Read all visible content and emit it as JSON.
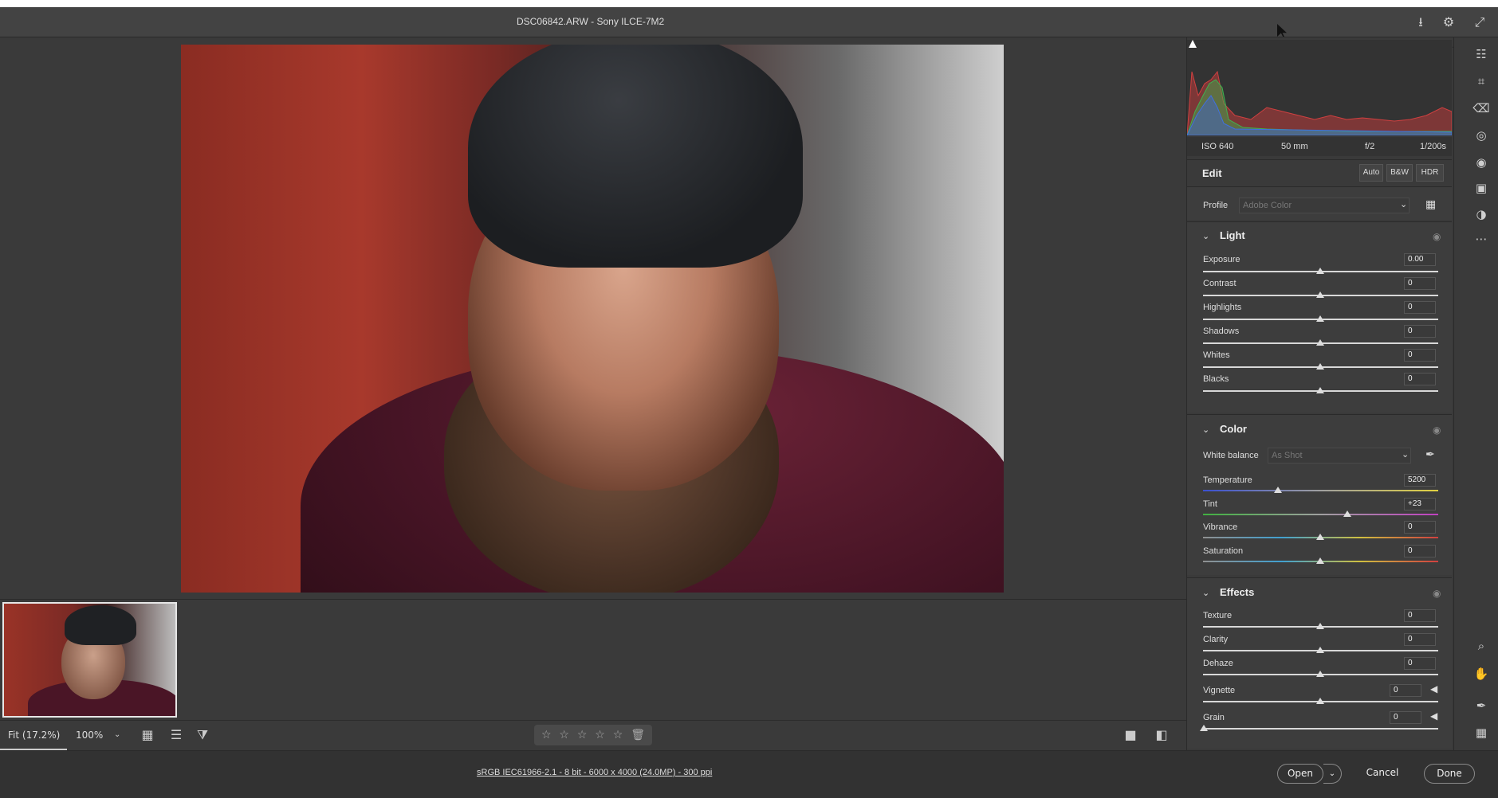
{
  "window": {
    "title": "DSC06842.ARW  -  Sony ILCE-7M2",
    "icons": [
      "download-icon",
      "gear-icon",
      "expand-icon"
    ]
  },
  "viewer": {
    "fit_label": "Fit (17.2%)",
    "zoom_label": "100%",
    "rating_stars": 0
  },
  "status": {
    "info": "sRGB IEC61966-2.1 - 8 bit - 6000 x 4000 (24.0MP) - 300 ppi",
    "open": "Open",
    "cancel": "Cancel",
    "done": "Done"
  },
  "exif": {
    "iso": "ISO 640",
    "focal": "50 mm",
    "aperture": "f/2",
    "shutter": "1/200s"
  },
  "edit": {
    "title": "Edit",
    "auto": "Auto",
    "bw": "B&W",
    "hdr": "HDR",
    "profile_label": "Profile",
    "profile_value": "Adobe Color"
  },
  "light": {
    "title": "Light",
    "exposure": {
      "label": "Exposure",
      "value": "0.00"
    },
    "contrast": {
      "label": "Contrast",
      "value": "0"
    },
    "highlights": {
      "label": "Highlights",
      "value": "0"
    },
    "shadows": {
      "label": "Shadows",
      "value": "0"
    },
    "whites": {
      "label": "Whites",
      "value": "0"
    },
    "blacks": {
      "label": "Blacks",
      "value": "0"
    }
  },
  "color": {
    "title": "Color",
    "wb_label": "White balance",
    "wb_value": "As Shot",
    "temperature": {
      "label": "Temperature",
      "value": "5200"
    },
    "tint": {
      "label": "Tint",
      "value": "+23"
    },
    "vibrance": {
      "label": "Vibrance",
      "value": "0"
    },
    "saturation": {
      "label": "Saturation",
      "value": "0"
    }
  },
  "effects": {
    "title": "Effects",
    "texture": {
      "label": "Texture",
      "value": "0"
    },
    "clarity": {
      "label": "Clarity",
      "value": "0"
    },
    "dehaze": {
      "label": "Dehaze",
      "value": "0"
    },
    "vignette": {
      "label": "Vignette",
      "value": "0"
    },
    "grain": {
      "label": "Grain",
      "value": "0"
    }
  },
  "colors": {
    "background": "#323232",
    "panel": "#3a3a3a",
    "accent": "#ffffff"
  }
}
